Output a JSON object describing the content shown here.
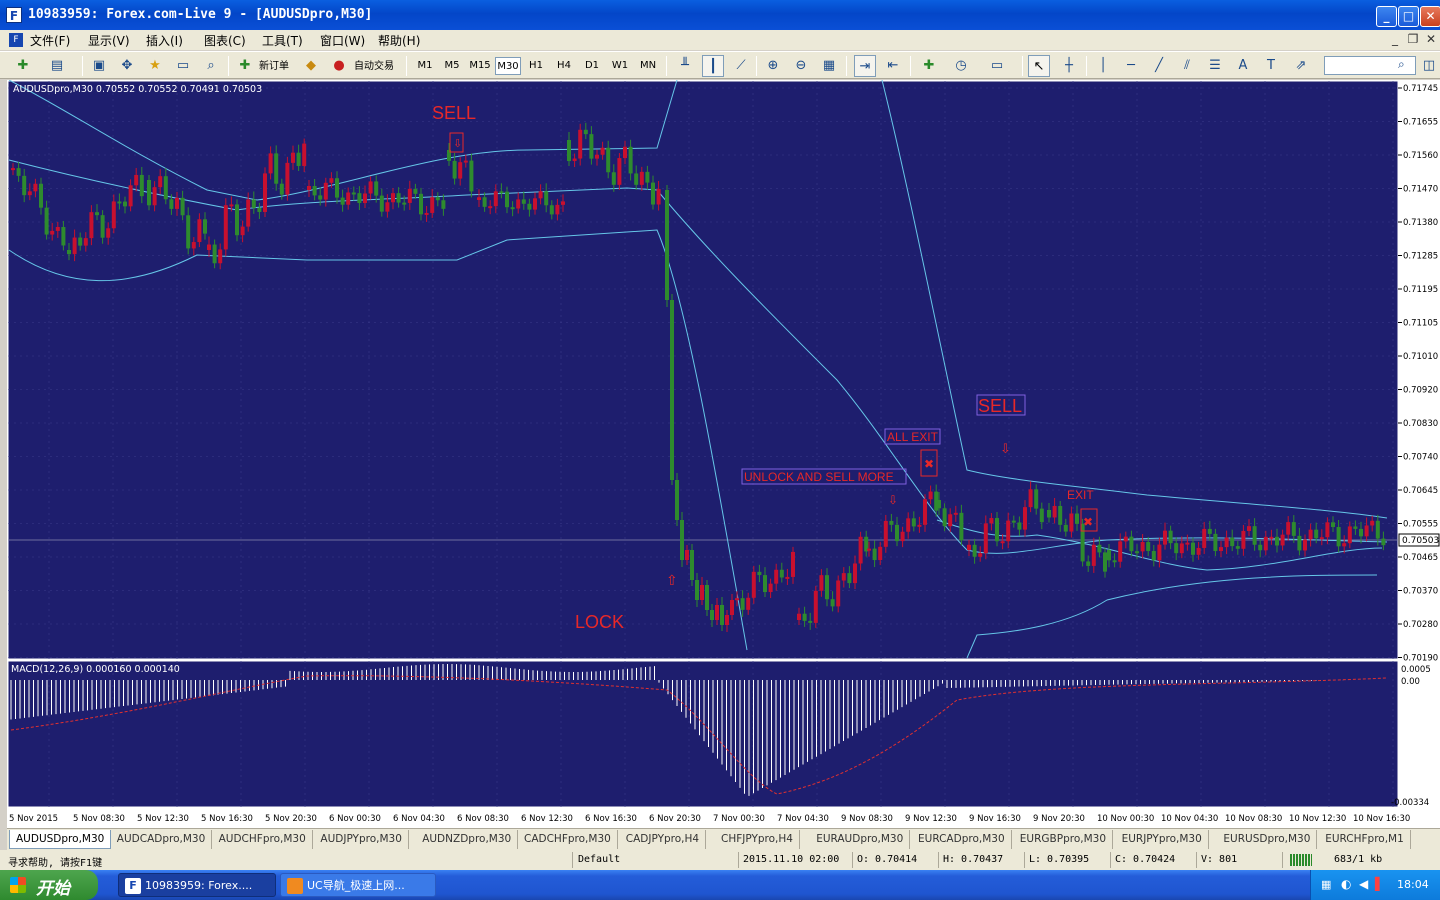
{
  "window": {
    "title": "10983959: Forex.com-Live 9 - [AUDUSDpro,M30]",
    "app_icon": "F",
    "controls": [
      "_",
      "□",
      "✕"
    ]
  },
  "menu": {
    "items": [
      "文件(F)",
      "显示(V)",
      "插入(I)",
      "图表(C)",
      "工具(T)",
      "窗口(W)",
      "帮助(H)"
    ],
    "mdi_controls": [
      "_",
      "❐",
      "✕"
    ]
  },
  "toolbar": {
    "new_order": "新订单",
    "auto_trading": "自动交易",
    "timeframes": [
      "M1",
      "M5",
      "M15",
      "M30",
      "H1",
      "H4",
      "D1",
      "W1",
      "MN"
    ],
    "active_timeframe": "M30",
    "search_placeholder": ""
  },
  "chart": {
    "header": "AUDUSDpro,M30  0.70552 0.70552 0.70491 0.70503",
    "current_price": "0.70503",
    "price_axis": [
      "0.71745",
      "0.71655",
      "0.71560",
      "0.71470",
      "0.71380",
      "0.71285",
      "0.71195",
      "0.71105",
      "0.71010",
      "0.70920",
      "0.70830",
      "0.70740",
      "0.70645",
      "0.70555",
      "0.70465",
      "0.70370",
      "0.70280",
      "0.70190"
    ],
    "time_axis": [
      "5 Nov 2015",
      "5 Nov 08:30",
      "5 Nov 12:30",
      "5 Nov 16:30",
      "5 Nov 20:30",
      "6 Nov 00:30",
      "6 Nov 04:30",
      "6 Nov 08:30",
      "6 Nov 12:30",
      "6 Nov 16:30",
      "6 Nov 20:30",
      "7 Nov 00:30",
      "7 Nov 04:30",
      "9 Nov 08:30",
      "9 Nov 12:30",
      "9 Nov 16:30",
      "9 Nov 20:30",
      "10 Nov 00:30",
      "10 Nov 04:30",
      "10 Nov 08:30",
      "10 Nov 12:30",
      "10 Nov 16:30"
    ],
    "annotations": {
      "sell1": "SELL",
      "lock": "LOCK",
      "unlock": "UNLOCK AND SELL MORE",
      "all_exit": "ALL EXIT",
      "sell2": "SELL",
      "exit": "EXIT"
    },
    "indicator_header": "MACD(12,26,9) 0.000160 0.000140",
    "indicator_axis": [
      "0.0005",
      "0.00",
      "-0.00334"
    ],
    "colors": {
      "background": "#1e1e6e",
      "bull": "#c8102e",
      "bear": "#2e8b2e",
      "bands": "#66c6e8",
      "signal": "#e03030"
    }
  },
  "tabs": [
    "AUDUSDpro,M30",
    "AUDCADpro,M30",
    "AUDCHFpro,M30",
    "AUDJPYpro,M30",
    "AUDNZDpro,M30",
    "CADCHFpro,M30",
    "CADJPYpro,H4",
    "CHFJPYpro,H4",
    "EURAUDpro,M30",
    "EURCADpro,M30",
    "EURGBPpro,M30",
    "EURJPYpro,M30",
    "EURUSDpro,M30",
    "EURCHFpro,M1"
  ],
  "status": {
    "help": "寻求帮助, 请按F1键",
    "profile": "Default",
    "datetime": "2015.11.10 02:00",
    "open": "O: 0.70414",
    "high": "H: 0.70437",
    "low": "L: 0.70395",
    "close": "C: 0.70424",
    "volume": "V: 801",
    "traffic": "683/1 kb"
  },
  "taskbar": {
    "start": "开始",
    "tasks": [
      "10983959: Forex....",
      "UC导航_极速上网..."
    ],
    "clock": "18:04"
  }
}
